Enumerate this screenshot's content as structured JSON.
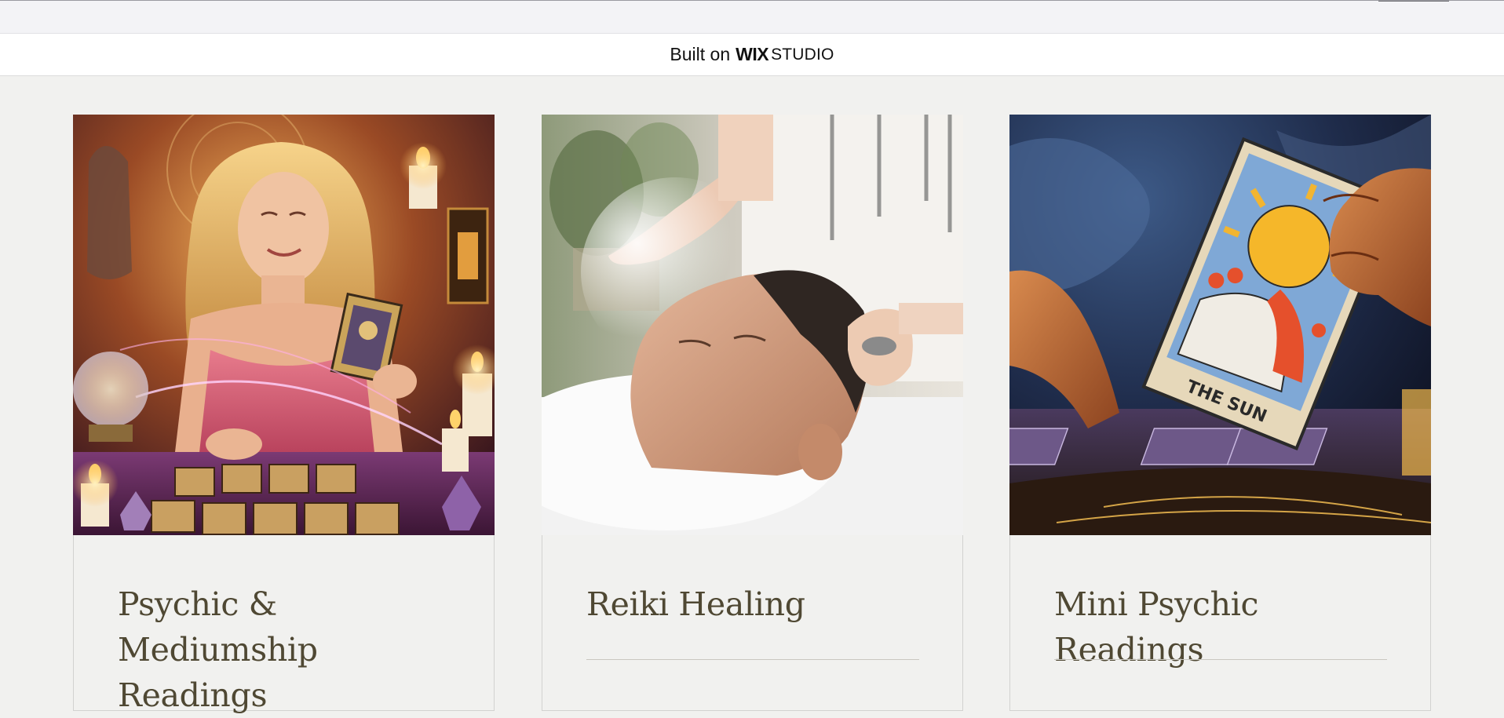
{
  "banner": {
    "built_on": "Built on",
    "wix": "WIX",
    "studio": "STUDIO"
  },
  "services": [
    {
      "title": "Psychic & Mediumship Readings",
      "image_icon": "psychic-reader-image"
    },
    {
      "title": "Reiki Healing",
      "image_icon": "reiki-healing-image"
    },
    {
      "title": "Mini Psychic Readings",
      "image_icon": "tarot-sun-card-image"
    }
  ],
  "images": {
    "tarot_card_text": "THE SUN"
  },
  "colors": {
    "page_background": "#f1f1ef",
    "title_text": "#4f4833",
    "banner_background": "#ffffff"
  }
}
